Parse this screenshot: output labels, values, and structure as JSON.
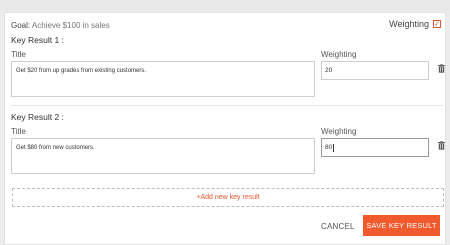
{
  "goal": {
    "label": "Goal:",
    "text": "Achieve $100 in sales"
  },
  "weighting_toggle": {
    "label": "Weighting",
    "checked": true,
    "check_glyph": "✓"
  },
  "key_results": [
    {
      "heading": "Key Result 1 :",
      "title_label": "Title",
      "title_value": "Get $20 from up grades from existing customers.",
      "weighting_label": "Weighting",
      "weighting_value": "20"
    },
    {
      "heading": "Key Result 2 :",
      "title_label": "Title",
      "title_value": "Get $80 from new customers.",
      "weighting_label": "Weighting",
      "weighting_value": "80"
    }
  ],
  "add_key_result": {
    "label": "+Add new key result"
  },
  "actions": {
    "cancel_label": "CANCEL",
    "save_label": "SAVE KEY RESULT"
  },
  "colors": {
    "accent": "#f05a2c",
    "text": "#333333",
    "border": "#cfcfcf"
  },
  "icons": {
    "delete": "trash-icon"
  }
}
